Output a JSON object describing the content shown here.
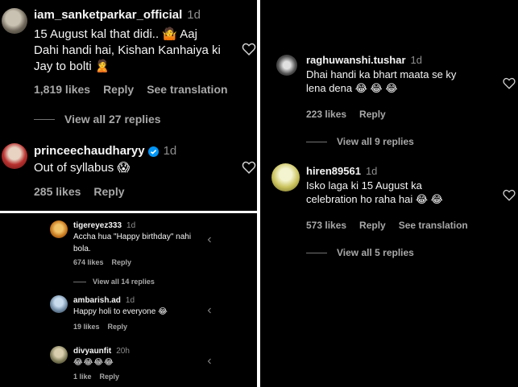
{
  "comments_left_top": [
    {
      "username": "iam_sanketparkar_official",
      "age": "1d",
      "text_lines": [
        "15 August kal that didi.. 🤷 Aaj",
        "Dahi handi hai, Kishan Kanhaiya ki",
        "Jay to bolti 🙎"
      ],
      "likes": "1,819 likes",
      "reply": "Reply",
      "translate": "See translation",
      "view_replies": "View all 27 replies"
    },
    {
      "username": "princeechaudharyy",
      "age": "1d",
      "text": "Out of syllabus 😱",
      "likes": "285 likes",
      "reply": "Reply"
    }
  ],
  "comments_left_bottom": [
    {
      "username": "tigereyez333",
      "age": "1d",
      "text_lines": [
        "Accha hua \"Happy birthday\" nahi",
        "bola."
      ],
      "likes": "674 likes",
      "reply": "Reply",
      "view_replies": "View all 14 replies"
    },
    {
      "username": "ambarish.ad",
      "age": "1d",
      "text": "Happy holi to everyone 😂",
      "likes": "19 likes",
      "reply": "Reply"
    },
    {
      "username": "divyaunfit",
      "age": "20h",
      "text": "😂😂😂😂",
      "likes": "1 like",
      "reply": "Reply"
    }
  ],
  "comments_right": [
    {
      "username": "raghuwanshi.tushar",
      "age": "1d",
      "text_lines": [
        "Dhai handi ka bhart maata se ky",
        "lena dena 😂 😂 😂"
      ],
      "likes": "223 likes",
      "reply": "Reply",
      "view_replies": "View all 9 replies"
    },
    {
      "username": "hiren89561",
      "age": "1d",
      "text_lines": [
        "Isko laga ki 15 August ka",
        "celebration ho raha hai 😂 😂"
      ],
      "likes": "573 likes",
      "reply": "Reply",
      "translate": "See translation",
      "view_replies": "View all 5 replies"
    }
  ],
  "colors": {
    "background": "#000000",
    "text": "#f5f5f5",
    "muted": "#a8a8a8",
    "verified": "#0095f6"
  },
  "icons": [
    "heart-icon",
    "verified-badge-icon"
  ]
}
